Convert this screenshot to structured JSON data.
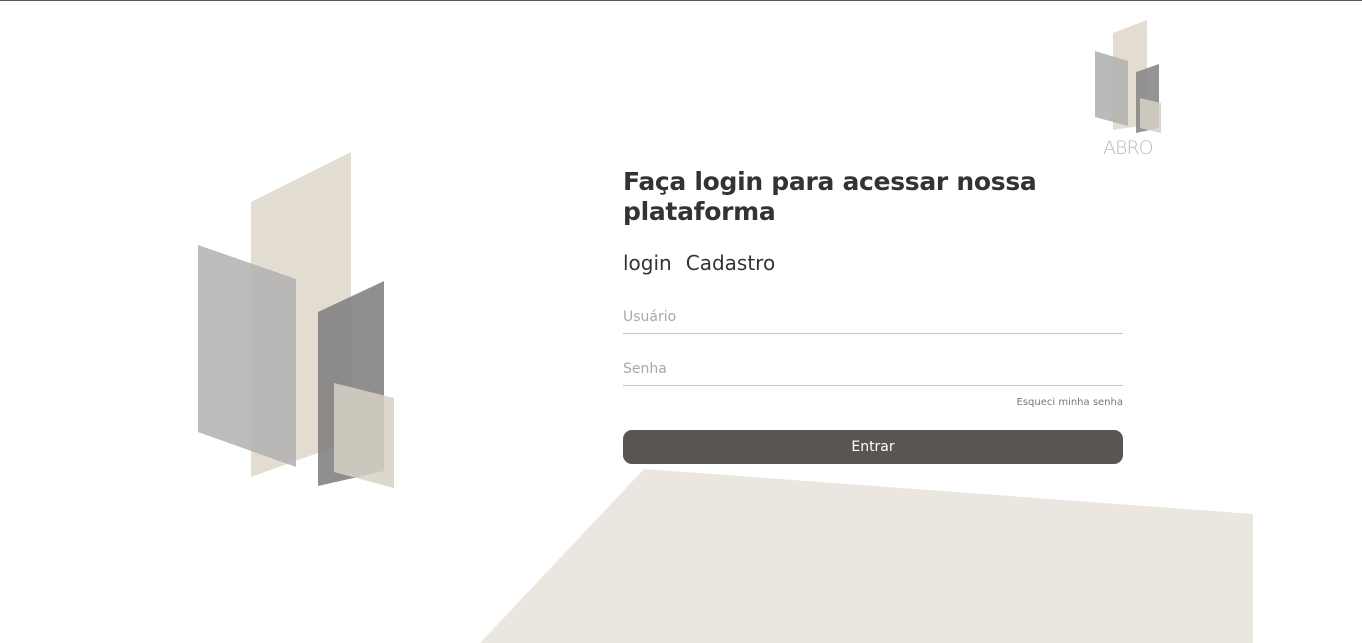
{
  "brand": {
    "logo_text": "ABRO"
  },
  "login": {
    "title": "Faça login para acessar nossa plataforma",
    "tabs": [
      {
        "label": "login"
      },
      {
        "label": "Cadastro"
      }
    ],
    "username_placeholder": "Usuário",
    "password_placeholder": "Senha",
    "forgot_label": "Esqueci minha senha",
    "submit_label": "Entrar"
  },
  "colors": {
    "button": "#5a5553",
    "beige": "#e3ddd1",
    "gray_light": "#bcbcbc",
    "gray_dark": "#8a8a8a",
    "background_shape": "#ebe6df",
    "text": "#333333"
  }
}
